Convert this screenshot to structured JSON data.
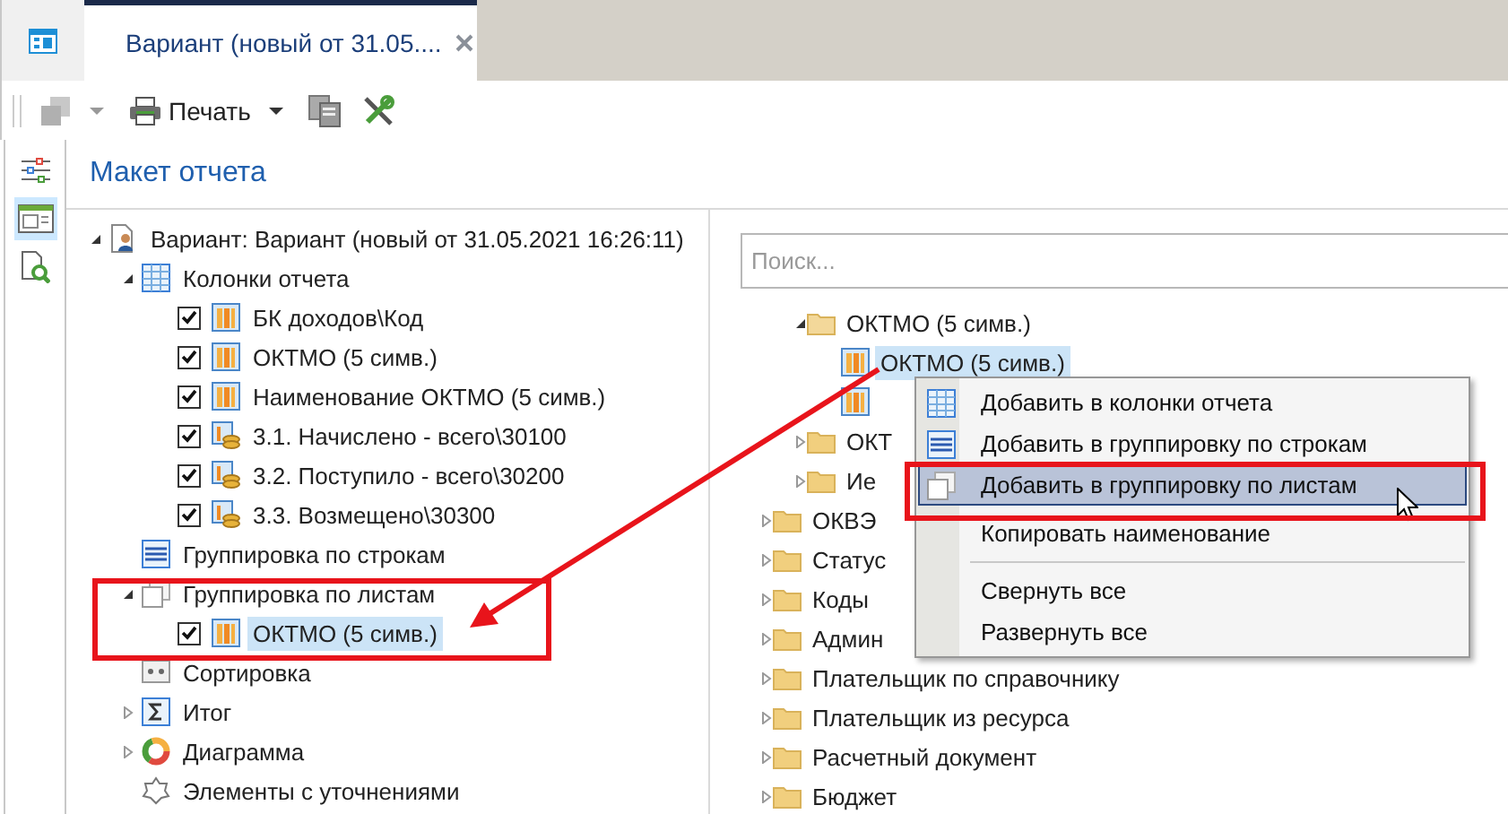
{
  "tabs": [
    {
      "kind": "home",
      "selected": false
    },
    {
      "kind": "document",
      "label": "Вариант (новый от 31.05....",
      "selected": true
    }
  ],
  "toolbar": {
    "print_label": "Печать"
  },
  "sidebar": {
    "items": [
      {
        "kind": "sliders",
        "selected": false
      },
      {
        "kind": "layout",
        "selected": true
      },
      {
        "kind": "preview",
        "selected": false
      }
    ]
  },
  "panel_title": "Макет отчета",
  "layout_tree": [
    {
      "label": "Вариант: Вариант (новый от 31.05.2021 16:26:11)",
      "kind": "variant",
      "expanded": true,
      "selected": false,
      "children": [
        {
          "label": "Колонки отчета",
          "kind": "columns",
          "expanded": true,
          "selected": false,
          "children": [
            {
              "label": "БК доходов\\Код",
              "kind": "field",
              "checked": true,
              "selected": false
            },
            {
              "label": "ОКТМО (5 симв.)",
              "kind": "field",
              "checked": true,
              "selected": false
            },
            {
              "label": "Наименование ОКТМО (5 симв.)",
              "kind": "field",
              "checked": true,
              "selected": false
            },
            {
              "label": "3.1. Начислено - всего\\30100",
              "kind": "measure",
              "checked": true,
              "selected": false
            },
            {
              "label": "3.2. Поступило - всего\\30200",
              "kind": "measure",
              "checked": true,
              "selected": false
            },
            {
              "label": "3.3. Возмещено\\30300",
              "kind": "measure",
              "checked": true,
              "selected": false
            }
          ]
        },
        {
          "label": "Группировка по строкам",
          "kind": "rows",
          "selected": false
        },
        {
          "label": "Группировка по листам",
          "kind": "sheets",
          "expanded": true,
          "selected": false,
          "children": [
            {
              "label": "ОКТМО (5 симв.)",
              "kind": "field",
              "checked": true,
              "selected": true
            }
          ]
        },
        {
          "label": "Сортировка",
          "kind": "sort",
          "selected": false
        },
        {
          "label": "Итог",
          "kind": "total",
          "expanded": false,
          "selected": false
        },
        {
          "label": "Диаграмма",
          "kind": "chart",
          "expanded": false,
          "selected": false
        },
        {
          "label": "Элементы с уточнениями",
          "kind": "refine",
          "selected": false
        }
      ]
    }
  ],
  "search": {
    "placeholder": "Поиск..."
  },
  "field_tree": [
    {
      "children": [
        {
          "label": "ОКТМО (5 симв.)",
          "kind": "folder",
          "expanded": true,
          "selected": false,
          "children": [
            {
              "label": "ОКТМО (5 симв.)",
              "kind": "field",
              "selected": true
            },
            {
              "kind": "field"
            }
          ]
        },
        {
          "label": "ОКТ",
          "kind": "folder",
          "expanded": false,
          "selected": false
        },
        {
          "label": "Ие",
          "kind": "folder",
          "expanded": false,
          "selected": false
        }
      ]
    },
    {
      "label": "ОКВЭ",
      "kind": "folder",
      "expanded": false,
      "selected": false
    },
    {
      "label": "Статус",
      "kind": "folder",
      "expanded": false,
      "selected": false
    },
    {
      "label": "Коды",
      "kind": "folder",
      "expanded": false,
      "selected": false
    },
    {
      "label": "Админ",
      "kind": "folder",
      "expanded": false,
      "selected": false
    },
    {
      "label": "Плательщик по справочнику",
      "kind": "folder",
      "expanded": false,
      "selected": false
    },
    {
      "label": "Плательщик из ресурса",
      "kind": "folder",
      "expanded": false,
      "selected": false
    },
    {
      "label": "Расчетный документ",
      "kind": "folder",
      "expanded": false,
      "selected": false
    },
    {
      "label": "Бюджет",
      "kind": "folder",
      "expanded": false,
      "selected": false
    }
  ],
  "context_menu": [
    {
      "kind": "columns",
      "label": "Добавить в колонки отчета",
      "selected": false
    },
    {
      "kind": "rows",
      "label": "Добавить в группировку по строкам",
      "selected": false
    },
    {
      "kind": "sheets",
      "label": "Добавить в группировку по листам",
      "selected": true
    },
    {
      "kind": "plain",
      "label": "Копировать наименование",
      "selected": false
    },
    {
      "kind": "separator"
    },
    {
      "kind": "plain",
      "label": "Свернуть все",
      "selected": false
    },
    {
      "kind": "plain",
      "label": "Развернуть все",
      "selected": false
    }
  ]
}
